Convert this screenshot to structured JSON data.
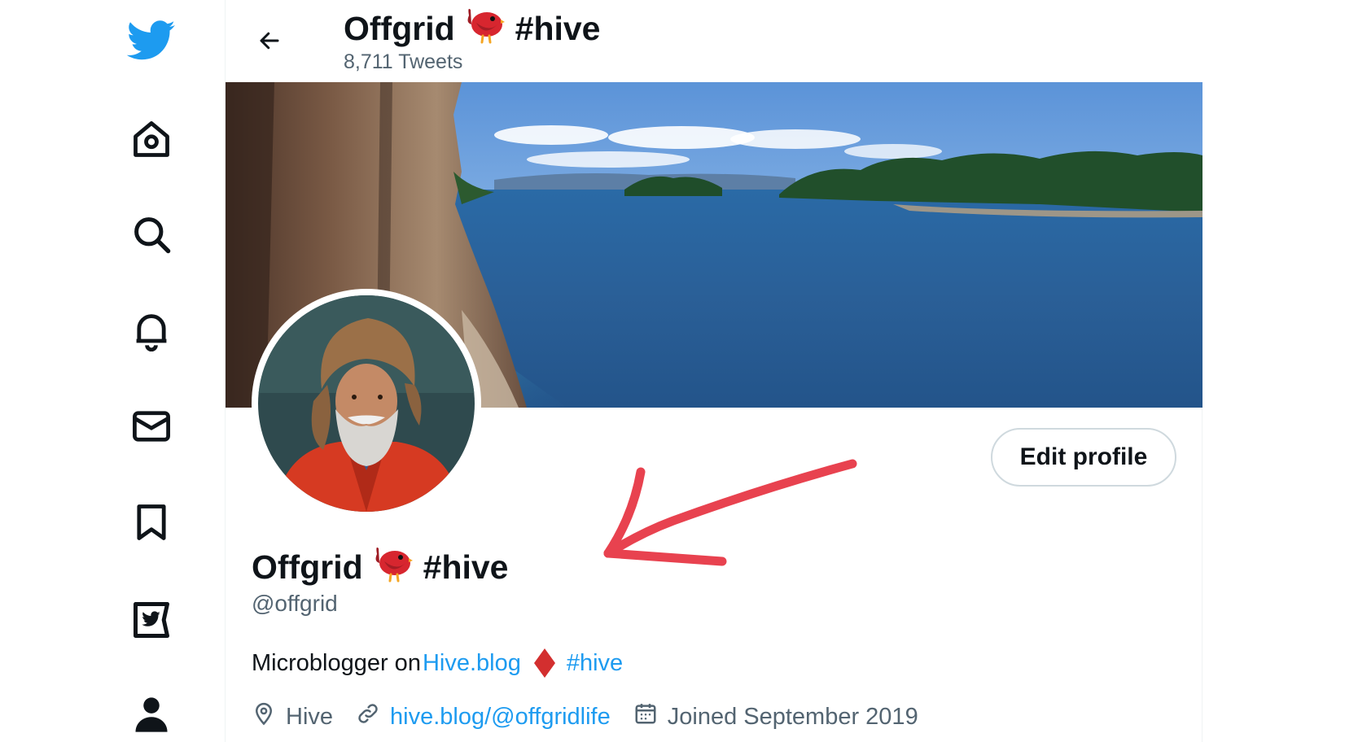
{
  "nav": {
    "items": [
      "logo",
      "home",
      "explore",
      "notifications",
      "messages",
      "bookmarks",
      "twitter-blue",
      "profile"
    ]
  },
  "header": {
    "name": "Offgrid",
    "hashtag": "#hive",
    "tweet_count": "8,711 Tweets"
  },
  "profile": {
    "name": "Offgrid",
    "hashtag": "#hive",
    "handle": "@offgrid",
    "edit_label": "Edit profile",
    "bio_prefix": "Microblogger on",
    "bio_link": "Hive.blog",
    "bio_hashtag": "#hive",
    "location": "Hive",
    "website": "hive.blog/@offgridlife",
    "joined": "Joined September 2019"
  },
  "colors": {
    "brand": "#1d9bf0",
    "secondary_text": "#536471",
    "annotation_arrow": "#e8424f",
    "hive_diamond": "#d32f2f"
  }
}
